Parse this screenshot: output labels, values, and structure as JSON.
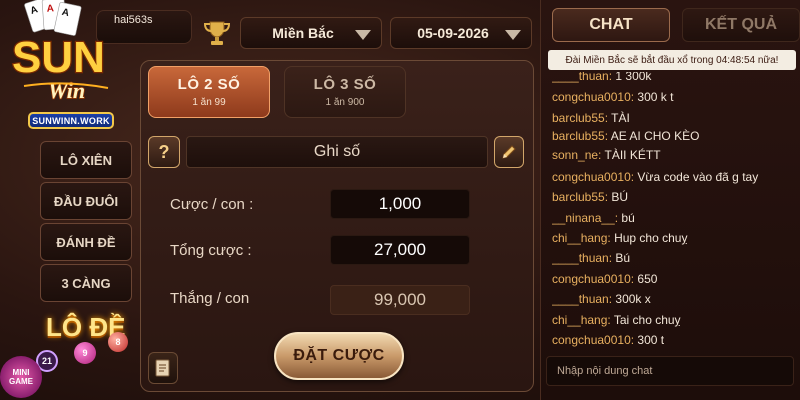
{
  "header": {
    "username": "hai563s",
    "region": "Miền Bắc",
    "date": "05-09-2026"
  },
  "logo": {
    "brand": "SUN Win",
    "badge": "SUNWINN.WORK"
  },
  "sidebar": {
    "items": [
      {
        "label": ""
      },
      {
        "label": "LÔ XIÊN"
      },
      {
        "label": "ĐẦU ĐUÔI"
      },
      {
        "label": "ĐÁNH ĐỀ"
      },
      {
        "label": "3 CÀNG"
      }
    ],
    "promo_label": "LÔ ĐỀ",
    "minigame_label": "MINI GAME",
    "minigame_count": "21",
    "balls": [
      "9",
      "8"
    ]
  },
  "bet_tabs": [
    {
      "title": "LÔ 2 SỐ",
      "sub": "1 ăn 99"
    },
    {
      "title": "LÔ 3 SỐ",
      "sub": "1 ăn 900"
    }
  ],
  "form": {
    "help_label": "?",
    "number_input_label": "Ghi số",
    "rows": [
      {
        "label": "Cược / con :",
        "value": "1,000"
      },
      {
        "label": "Tổng cược :",
        "value": "27,000"
      },
      {
        "label": "Thắng / con",
        "value": "99,000"
      }
    ],
    "submit_label": "ĐẶT CƯỢC"
  },
  "chat": {
    "tabs": [
      {
        "label": "CHAT"
      },
      {
        "label": "KẾT QUẢ"
      }
    ],
    "notice": "Đài Miền Bắc sẽ bắt đầu xổ trong 04:48:54 nữa!",
    "messages": [
      {
        "user": "____thuan:",
        "text": "1 300k"
      },
      {
        "user": "congchua0010:",
        "text": "300 k t"
      },
      {
        "user": "barclub55:",
        "text": "TÀI"
      },
      {
        "user": "barclub55:",
        "text": "AE AI CHO KÈO"
      },
      {
        "user": "sonn_ne:",
        "text": "TÀII KÉTT"
      },
      {
        "user": "congchua0010:",
        "text": "Vừa code vào đã g tay"
      },
      {
        "user": "barclub55:",
        "text": "BÚ"
      },
      {
        "user": "__ninana__:",
        "text": "bú"
      },
      {
        "user": "chi__hang:",
        "text": "Hup cho chuỵ"
      },
      {
        "user": "____thuan:",
        "text": "Bú"
      },
      {
        "user": "congchua0010:",
        "text": "650"
      },
      {
        "user": "____thuan:",
        "text": "300k x"
      },
      {
        "user": "chi__hang:",
        "text": "Tai cho chuỵ"
      },
      {
        "user": "congchua0010:",
        "text": "300 t"
      }
    ],
    "input_placeholder": "Nhập nội dung chat"
  },
  "colors": {
    "accent_orange": "#c8683a",
    "chat_username": "#e8b060",
    "gold": "#f2c84a"
  }
}
